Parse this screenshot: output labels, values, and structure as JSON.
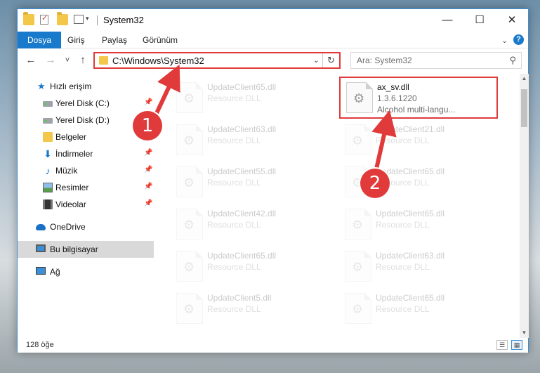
{
  "window": {
    "title": "System32",
    "controls": {
      "minimize": "—",
      "maximize": "☐",
      "close": "✕"
    }
  },
  "ribbon": {
    "tabs": [
      "Dosya",
      "Giriş",
      "Paylaş",
      "Görünüm"
    ],
    "help": "?"
  },
  "nav": {
    "back": "←",
    "forward": "→",
    "recent": "˅",
    "up": "↑",
    "address": "C:\\Windows\\System32",
    "refresh": "↻",
    "search_placeholder": "Ara: System32"
  },
  "sidebar": {
    "items": [
      {
        "label": "Hızlı erişim",
        "icon": "star-icon",
        "pinned": false
      },
      {
        "label": "Yerel Disk (C:)",
        "icon": "drive-icon",
        "pinned": true
      },
      {
        "label": "Yerel Disk (D:)",
        "icon": "drive-icon",
        "pinned": false
      },
      {
        "label": "Belgeler",
        "icon": "documents-icon",
        "pinned": false
      },
      {
        "label": "İndirmeler",
        "icon": "download-icon",
        "pinned": true
      },
      {
        "label": "Müzik",
        "icon": "music-icon",
        "pinned": true
      },
      {
        "label": "Resimler",
        "icon": "pictures-icon",
        "pinned": true
      },
      {
        "label": "Videolar",
        "icon": "videos-icon",
        "pinned": true
      },
      {
        "label": "OneDrive",
        "icon": "cloud-icon",
        "pinned": false
      },
      {
        "label": "Bu bilgisayar",
        "icon": "computer-icon",
        "pinned": false
      },
      {
        "label": "Ağ",
        "icon": "network-icon",
        "pinned": false
      }
    ]
  },
  "files": {
    "highlighted": {
      "name": "ax_sv.dll",
      "version": "1.3.6.1220",
      "description": "Alcohol multi-langu..."
    },
    "left_column": [
      {
        "name": "UpdateClient65.dll",
        "type": "Resource DLL"
      },
      {
        "name": "UpdateClient63.dll",
        "type": "Resource DLL"
      },
      {
        "name": "UpdateClient55.dll",
        "type": "Resource DLL"
      },
      {
        "name": "UpdateClient42.dll",
        "type": "Resource DLL"
      },
      {
        "name": "UpdateClient65.dll",
        "type": "Resource DLL"
      },
      {
        "name": "UpdateClient5.dll",
        "type": "Resource DLL"
      }
    ],
    "right_column": [
      {
        "name": "UpdateClient21.dll",
        "type": "Resource DLL"
      },
      {
        "name": "UpdateClient65.dll",
        "type": "Resource DLL"
      },
      {
        "name": "UpdateClient65.dll",
        "type": "Resource DLL"
      },
      {
        "name": "UpdateClient63.dll",
        "type": "Resource DLL"
      },
      {
        "name": "UpdateClient65.dll",
        "type": "Resource DLL"
      }
    ]
  },
  "status": {
    "item_count": "128 öğe"
  },
  "annotations": {
    "step1": "1",
    "step2": "2",
    "color": "#e03a3a"
  }
}
